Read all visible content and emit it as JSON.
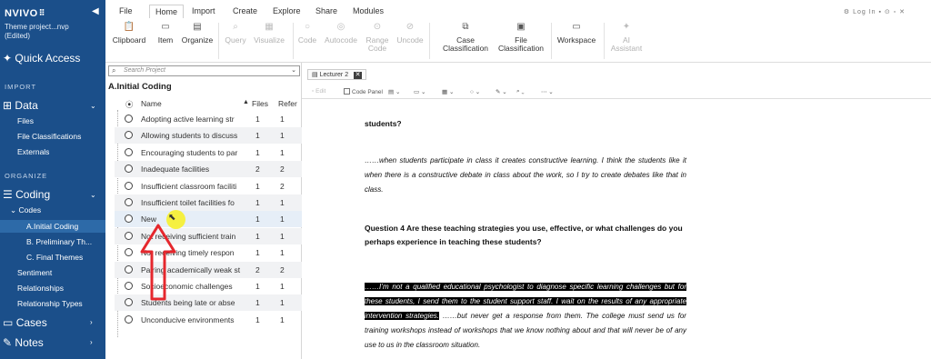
{
  "app": {
    "brand": "NVIVO",
    "brand_mark": "⠿",
    "project_line1": "Theme project...nvp",
    "project_line2": "(Edited)"
  },
  "sidebar": {
    "quick_access": "Quick Access",
    "import_label": "IMPORT",
    "data": {
      "label": "Data",
      "items": [
        "Files",
        "File Classifications",
        "Externals"
      ]
    },
    "organize_label": "ORGANIZE",
    "coding": {
      "label": "Coding",
      "codes_label": "Codes",
      "code_items": [
        "A.Initial Coding",
        "B. Preliminary Th...",
        "C. Final Themes"
      ],
      "items": [
        "Sentiment",
        "Relationships",
        "Relationship Types"
      ]
    },
    "cases": "Cases",
    "notes": "Notes"
  },
  "ribbon": {
    "tabs": [
      "File",
      "Home",
      "Import",
      "Create",
      "Explore",
      "Share",
      "Modules"
    ],
    "active_tab": "Home",
    "right_tools": "⚙ Log In  ▪  ⊙  ▫  ✕",
    "buttons": [
      {
        "label": "Clipboard",
        "icon": "clipboard-icon",
        "glyph": "📋",
        "enabled": true
      },
      {
        "label": "Item",
        "icon": "item-icon",
        "glyph": "▭",
        "enabled": true
      },
      {
        "label": "Organize",
        "icon": "organize-icon",
        "glyph": "▤",
        "enabled": true
      },
      {
        "label": "Query",
        "icon": "query-icon",
        "glyph": "⌕",
        "enabled": false
      },
      {
        "label": "Visualize",
        "icon": "visualize-icon",
        "glyph": "▦",
        "enabled": false
      },
      {
        "label": "Code",
        "icon": "code-icon",
        "glyph": "○",
        "enabled": false
      },
      {
        "label": "Autocode",
        "icon": "autocode-icon",
        "glyph": "◎",
        "enabled": false
      },
      {
        "label": "Range\nCode",
        "icon": "range-code-icon",
        "glyph": "⊙",
        "enabled": false
      },
      {
        "label": "Uncode",
        "icon": "uncode-icon",
        "glyph": "⊘",
        "enabled": false
      },
      {
        "label": "Case\nClassification",
        "icon": "case-classification-icon",
        "glyph": "⧉",
        "enabled": true
      },
      {
        "label": "File\nClassification",
        "icon": "file-classification-icon",
        "glyph": "▣",
        "enabled": true
      },
      {
        "label": "Workspace",
        "icon": "workspace-icon",
        "glyph": "▭",
        "enabled": true
      },
      {
        "label": "AI\nAssistant",
        "icon": "ai-assistant-icon",
        "glyph": "✦",
        "enabled": false
      }
    ]
  },
  "project_panel": {
    "search_placeholder": "Search Project",
    "title": "A.Initial Coding",
    "columns": {
      "name": "Name",
      "files": "Files",
      "refs": "Refer"
    },
    "rows": [
      {
        "name": "Adopting  active learning str",
        "files": "1",
        "refs": "1"
      },
      {
        "name": "Allowing students to discuss",
        "files": "1",
        "refs": "1"
      },
      {
        "name": "Encouraging students to par",
        "files": "1",
        "refs": "1"
      },
      {
        "name": "Inadequate facilities",
        "files": "2",
        "refs": "2"
      },
      {
        "name": "Insufficient classroom faciliti",
        "files": "1",
        "refs": "2"
      },
      {
        "name": "Insufficient toilet facilities fo",
        "files": "1",
        "refs": "1"
      },
      {
        "name": "New",
        "files": "1",
        "refs": "1"
      },
      {
        "name": "Not receiving sufficient train",
        "files": "1",
        "refs": "1"
      },
      {
        "name": "Not receiving timely respon",
        "files": "1",
        "refs": "1"
      },
      {
        "name": "Pairing academically weak st",
        "files": "2",
        "refs": "2"
      },
      {
        "name": "Socioeconomic challenges",
        "files": "1",
        "refs": "1"
      },
      {
        "name": "Students being late or abse",
        "files": "1",
        "refs": "1"
      },
      {
        "name": "Unconducive environments",
        "files": "1",
        "refs": "1"
      }
    ]
  },
  "document": {
    "tab_label": "Lecturer 2",
    "toolbar": {
      "edit": "Edit",
      "code_panel": "Code Panel"
    },
    "heading_tail": "students?",
    "para1": "……when students participate in class it creates constructive learning. I think the students like it when there is a constructive debate in class about the work, so I try to create debates like that in class.",
    "question4": "Question 4   Are these teaching strategies you use, effective, or what challenges do you perhaps experience in teaching these students?",
    "para2_highlight": "……I’m not a qualified educational psychologist to diagnose specific learning challenges but for these students, I send them to the student support staff. I wait on the results of any appropriate intervention strategies.",
    "para2_rest": "……but never get a response from them. The college must send us for training workshops instead of workshops that we know nothing about and that will never be of any use to us in the classroom situation."
  },
  "colors": {
    "sidebar_bg": "#1b4f8a",
    "annotation_arrow": "#e5272d",
    "cursor_highlight": "#f6ef2c"
  }
}
